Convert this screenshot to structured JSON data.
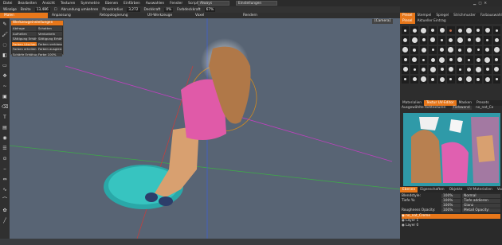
{
  "menu": [
    "Datei",
    "Bearbeiten",
    "Ansicht",
    "Texturen",
    "Symmetrie",
    "Ebenen",
    "Einfärben",
    "Auswahlen",
    "Fenster",
    "Scripts",
    "Hilfe"
  ],
  "window": {
    "app_combo": "Always",
    "mode_combo": "Einstellungen"
  },
  "options": {
    "brush_label": "Winzige",
    "brush_width_label": "Breite",
    "brush_width": "13,486",
    "smoothing_label": "Abrundung umkehren",
    "size_label": "Pinselradius",
    "size_value": "3,272",
    "opacity_label": "Deckkraft",
    "opacity_value": "0%",
    "color_opacity_label": "Farbdeckkraft",
    "color_opacity_value": "67%"
  },
  "room_tabs": [
    "Malen",
    "Anpassung",
    "Retopologierung",
    "UV-Werkzeuge",
    "Voxel",
    "Rendern"
  ],
  "active_room": "Malen",
  "camera_label": "[Camera]",
  "popup": {
    "title": "Werkzeugeinstellungen",
    "items": [
      "Abfrage",
      "Schatten",
      "Aufhellen",
      "Verdunkeln",
      "Sättigung Erhöhung",
      "Sättigung Erhöhen",
      "Farben Löschen",
      "Farben verblassen",
      "Farben erhellen",
      "Farben ausgleichen",
      "Schärfe Erhöhung",
      "Farbe 100%"
    ]
  },
  "right_tabs_top": [
    "Pinsel",
    "Stempel",
    "Spiegel",
    "Strichmuster",
    "Farbauswahl"
  ],
  "right_tabs_sub": [
    "Pinsel",
    "Aktueller Eintrag"
  ],
  "right_tabs_mid": [
    "Materialien",
    "Textur UV-Editor",
    "Masken",
    "Presets"
  ],
  "texture_header": "Ausgewählte Rohtexturen",
  "texture_mode": "Farbwand",
  "texture_name": "no_nat_Co",
  "layers_tabs": [
    "Ebenen",
    "Eigenschaften",
    "Objekte",
    "UV-Materialien",
    "Voxelbaum"
  ],
  "layer_props": [
    {
      "label": "Blendstyle:",
      "value": "100%",
      "mode": "Normal"
    },
    {
      "label": "Tiefe %:",
      "value": "100%",
      "mode": "Tiefe addieren"
    },
    {
      "label": "",
      "value": "100%",
      "mode": "Glanz"
    },
    {
      "label": "Roughness Opacity:",
      "value": "100%",
      "mode": "Metall Opacity:"
    }
  ],
  "layers": [
    "no_nat_Creme",
    "Layer 1",
    "Layer 0"
  ],
  "toolbar_icons": [
    "pencil-icon",
    "brush-icon",
    "airbrush-icon",
    "fill-icon",
    "select-icon",
    "move-icon",
    "smudge-icon",
    "stamp-icon",
    "eraser-icon",
    "text-icon",
    "gradient-icon",
    "eye-icon",
    "layers-icon",
    "picker-icon",
    "ruler-icon",
    "measure-icon",
    "spline-icon",
    "curve-icon",
    "butterfly-icon",
    "line-icon"
  ],
  "colors": {
    "accent": "#e8771a",
    "viewport": "#586474",
    "panel": "#2d2d2d"
  }
}
